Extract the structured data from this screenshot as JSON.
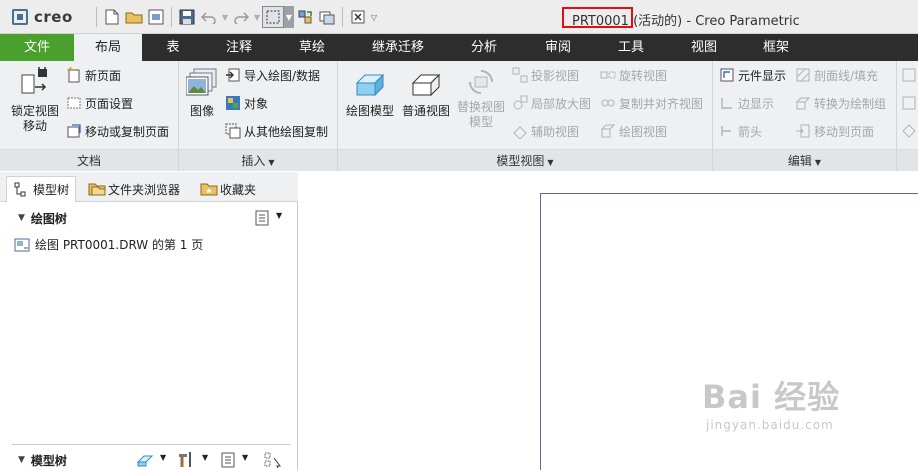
{
  "app": {
    "logo_text": "creo",
    "window_title": "(活动的) - Creo Parametric",
    "highlighted_name": "PRT0001"
  },
  "tabs": [
    {
      "label": "文件"
    },
    {
      "label": "布局"
    },
    {
      "label": "表"
    },
    {
      "label": "注释"
    },
    {
      "label": "草绘"
    },
    {
      "label": "继承迁移"
    },
    {
      "label": "分析"
    },
    {
      "label": "审阅"
    },
    {
      "label": "工具"
    },
    {
      "label": "视图"
    },
    {
      "label": "框架"
    }
  ],
  "ribbon": {
    "document": {
      "label": "文档",
      "lock_view_l1": "锁定视图",
      "lock_view_l2": "移动",
      "new_page": "新页面",
      "page_setup": "页面设置",
      "move_copy_page": "移动或复制页面"
    },
    "insert": {
      "label": "插入",
      "image": "图像",
      "import_drawing": "导入绘图/数据",
      "object": "对象",
      "copy_from_drawing": "从其他绘图复制"
    },
    "model_views": {
      "label": "模型视图",
      "drawing_model": "绘图模型",
      "general_view": "普通视图",
      "replace_view_l1": "替换视图",
      "replace_view_l2": "模型",
      "projection_view": "投影视图",
      "detailed_view": "局部放大图",
      "auxiliary_view": "辅助视图",
      "revolved_view": "旋转视图",
      "copy_align_view": "复制并对齐视图",
      "drawing_view": "绘图视图"
    },
    "edit": {
      "label": "编辑",
      "component_display": "元件显示",
      "edge_display": "边显示",
      "arrow": "箭头",
      "section_fill": "剖面线/填充",
      "convert_draft_group": "转换为绘制组",
      "move_to_page": "移动到页面"
    }
  },
  "panel": {
    "tabs": [
      {
        "label": "模型树"
      },
      {
        "label": "文件夹浏览器"
      },
      {
        "label": "收藏夹"
      }
    ],
    "drawing_tree_title": "绘图树",
    "drawing_tree_item": "绘图 PRT0001.DRW 的第 1 页",
    "model_tree_title": "模型树"
  },
  "watermark": {
    "main": "Bai 经验",
    "sub": "jingyan.baidu.com"
  },
  "colors": {
    "file_tab": "#4aa02c",
    "tab_bar": "#2d2d2d",
    "ribbon_bg": "#eef0f2",
    "highlight_box": "#e01010",
    "sheet_border": "#5a6c8e"
  }
}
